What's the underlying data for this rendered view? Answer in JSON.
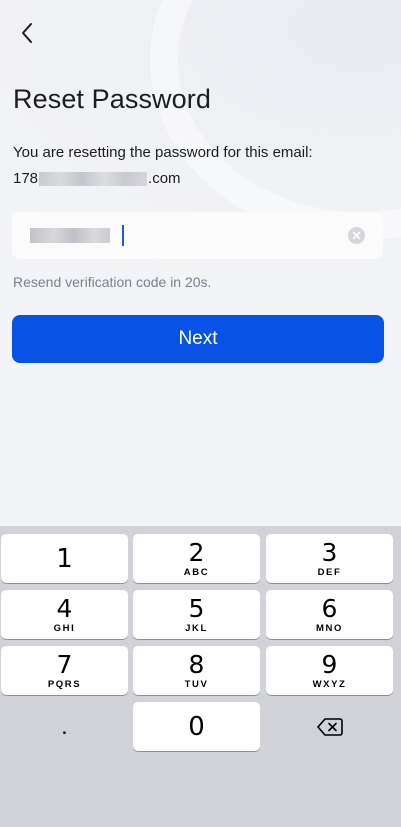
{
  "header": {
    "back_icon": "chevron-left-icon"
  },
  "title": "Reset Password",
  "description": "You are resetting the password for this email:",
  "email": {
    "prefix": "178",
    "suffix": ".com"
  },
  "input": {
    "clear_icon": "clear-circle-icon"
  },
  "resend_text": "Resend verification code in 20s.",
  "next_button": {
    "label": "Next",
    "color": "#0952e6"
  },
  "keyboard": {
    "keys": [
      {
        "digit": "1",
        "letters": ""
      },
      {
        "digit": "2",
        "letters": "ABC"
      },
      {
        "digit": "3",
        "letters": "DEF"
      },
      {
        "digit": "4",
        "letters": "GHI"
      },
      {
        "digit": "5",
        "letters": "JKL"
      },
      {
        "digit": "6",
        "letters": "MNO"
      },
      {
        "digit": "7",
        "letters": "PQRS"
      },
      {
        "digit": "8",
        "letters": "TUV"
      },
      {
        "digit": "9",
        "letters": "WXYZ"
      }
    ],
    "dot_key": ".",
    "zero_key": "0",
    "delete_icon": "backspace-icon"
  }
}
